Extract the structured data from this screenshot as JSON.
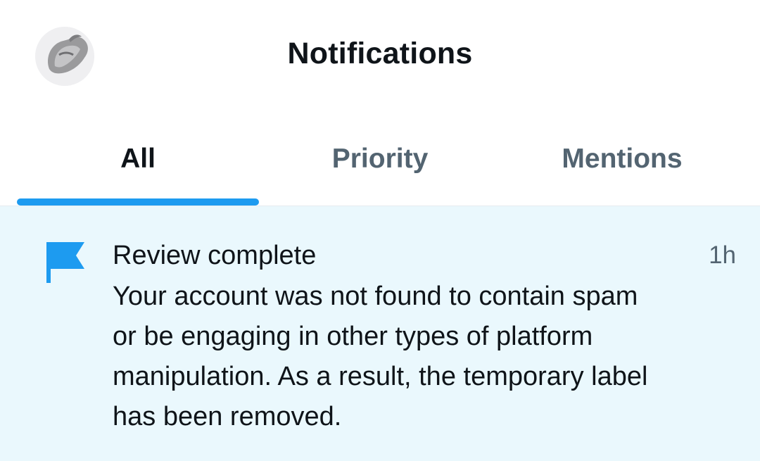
{
  "header": {
    "title": "Notifications",
    "avatar_icon": "profile-avatar"
  },
  "tabs": [
    {
      "label": "All",
      "active": true
    },
    {
      "label": "Priority",
      "active": false
    },
    {
      "label": "Mentions",
      "active": false
    }
  ],
  "notification": {
    "icon": "flag-icon",
    "title": "Review complete",
    "body": "Your account was not found to contain spam or be engaging in other types of platform manipulation. As a result, the temporary label has been removed.",
    "time": "1h"
  },
  "colors": {
    "accent": "#1d9bf0",
    "notification_bg": "#eaf8fd",
    "text_primary": "#0f1419",
    "text_secondary": "#536471"
  }
}
